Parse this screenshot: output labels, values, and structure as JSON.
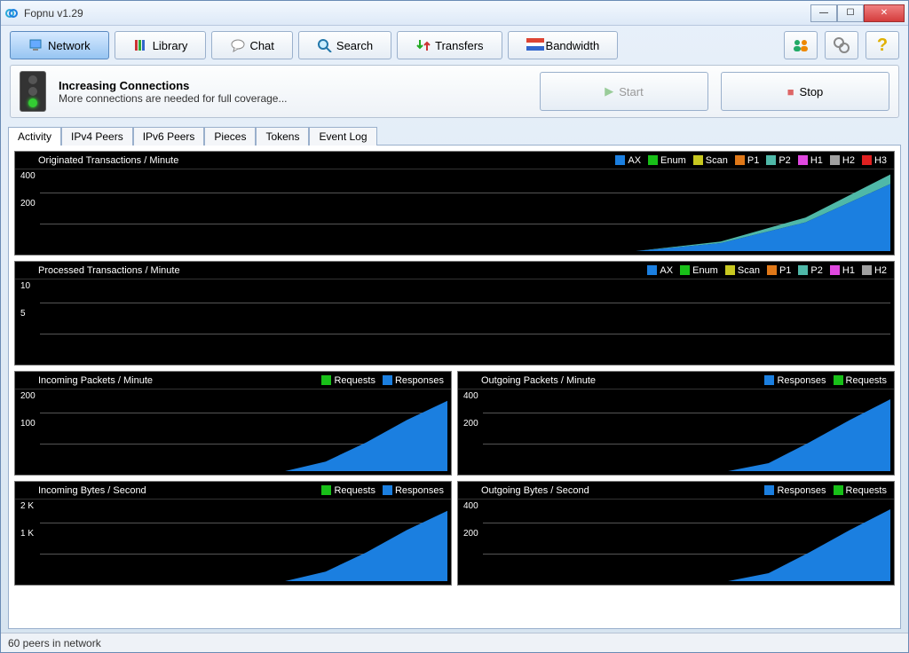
{
  "window": {
    "title": "Fopnu v1.29"
  },
  "toolbar": {
    "tabs": [
      {
        "label": "Network",
        "active": true
      },
      {
        "label": "Library",
        "active": false
      },
      {
        "label": "Chat",
        "active": false
      },
      {
        "label": "Search",
        "active": false
      },
      {
        "label": "Transfers",
        "active": false
      },
      {
        "label": "Bandwidth",
        "active": false
      }
    ]
  },
  "status": {
    "title": "Increasing Connections",
    "subtitle": "More connections are needed for full coverage...",
    "start_label": "Start",
    "stop_label": "Stop"
  },
  "subtabs": [
    "Activity",
    "IPv4 Peers",
    "IPv6 Peers",
    "Pieces",
    "Tokens",
    "Event Log"
  ],
  "subtab_active": 0,
  "legend_colors": {
    "AX": "#1b7fe0",
    "Enum": "#18c018",
    "Scan": "#c8c820",
    "P1": "#e07818",
    "P2": "#4fb8a8",
    "H1": "#e048e0",
    "H2": "#a0a0a0",
    "H3": "#e02020",
    "Requests": "#18c018",
    "Responses": "#1b7fe0"
  },
  "charts": [
    {
      "id": "orig",
      "title": "Originated Transactions / Minute",
      "full": true,
      "legend": [
        "AX",
        "Enum",
        "Scan",
        "P1",
        "P2",
        "H1",
        "H2",
        "H3"
      ],
      "yticks": [
        "400",
        "200"
      ]
    },
    {
      "id": "proc",
      "title": "Processed Transactions / Minute",
      "full": true,
      "legend": [
        "AX",
        "Enum",
        "Scan",
        "P1",
        "P2",
        "H1",
        "H2"
      ],
      "yticks": [
        "10",
        "5"
      ]
    },
    {
      "id": "ipk",
      "title": "Incoming Packets / Minute",
      "full": false,
      "legend": [
        "Requests",
        "Responses"
      ],
      "yticks": [
        "200",
        "100"
      ]
    },
    {
      "id": "opk",
      "title": "Outgoing Packets / Minute",
      "full": false,
      "legend": [
        "Responses",
        "Requests"
      ],
      "yticks": [
        "400",
        "200"
      ]
    },
    {
      "id": "ibs",
      "title": "Incoming Bytes / Second",
      "full": false,
      "legend": [
        "Requests",
        "Responses"
      ],
      "yticks": [
        "2 K",
        "1 K"
      ]
    },
    {
      "id": "obs",
      "title": "Outgoing Bytes / Second",
      "full": false,
      "legend": [
        "Responses",
        "Requests"
      ],
      "yticks": [
        "400",
        "200"
      ]
    }
  ],
  "chart_data": [
    {
      "id": "orig",
      "type": "area",
      "title": "Originated Transactions / Minute",
      "ylim": [
        0,
        500
      ],
      "x": [
        "t-10",
        "t-9",
        "t-8",
        "t-7",
        "t-6",
        "t-5",
        "t-4",
        "t-3",
        "t-2",
        "t-1",
        "now"
      ],
      "series": [
        {
          "name": "AX",
          "color": "#1b7fe0",
          "values": [
            0,
            0,
            0,
            0,
            0,
            0,
            0,
            0,
            50,
            180,
            420
          ]
        },
        {
          "name": "P2",
          "color": "#4fb8a8",
          "values": [
            0,
            0,
            0,
            0,
            0,
            0,
            0,
            0,
            10,
            30,
            60
          ]
        },
        {
          "name": "Enum",
          "color": "#18c018",
          "values": [
            0,
            0,
            0,
            0,
            0,
            0,
            0,
            0,
            0,
            0,
            0
          ]
        },
        {
          "name": "Scan",
          "color": "#c8c820",
          "values": [
            0,
            0,
            0,
            0,
            0,
            0,
            0,
            0,
            0,
            0,
            0
          ]
        },
        {
          "name": "P1",
          "color": "#e07818",
          "values": [
            0,
            0,
            0,
            0,
            0,
            0,
            0,
            0,
            0,
            0,
            0
          ]
        },
        {
          "name": "H1",
          "color": "#e048e0",
          "values": [
            0,
            0,
            0,
            0,
            0,
            0,
            0,
            0,
            0,
            0,
            0
          ]
        },
        {
          "name": "H2",
          "color": "#a0a0a0",
          "values": [
            0,
            0,
            0,
            0,
            0,
            0,
            0,
            0,
            0,
            0,
            0
          ]
        },
        {
          "name": "H3",
          "color": "#e02020",
          "values": [
            0,
            0,
            0,
            0,
            0,
            0,
            0,
            0,
            0,
            0,
            0
          ]
        }
      ]
    },
    {
      "id": "proc",
      "type": "area",
      "title": "Processed Transactions / Minute",
      "ylim": [
        0,
        12
      ],
      "x": [
        "t-10",
        "now"
      ],
      "series": [
        {
          "name": "AX",
          "color": "#1b7fe0",
          "values": [
            0,
            0
          ]
        },
        {
          "name": "Enum",
          "color": "#18c018",
          "values": [
            0,
            0
          ]
        },
        {
          "name": "Scan",
          "color": "#c8c820",
          "values": [
            0,
            0
          ]
        },
        {
          "name": "P1",
          "color": "#e07818",
          "values": [
            0,
            0
          ]
        },
        {
          "name": "P2",
          "color": "#4fb8a8",
          "values": [
            0,
            0
          ]
        },
        {
          "name": "H1",
          "color": "#e048e0",
          "values": [
            0,
            0
          ]
        },
        {
          "name": "H2",
          "color": "#a0a0a0",
          "values": [
            0,
            0
          ]
        }
      ]
    },
    {
      "id": "ipk",
      "type": "area",
      "title": "Incoming Packets / Minute",
      "ylim": [
        0,
        250
      ],
      "x": [
        "t-10",
        "t-9",
        "t-8",
        "t-7",
        "t-6",
        "t-5",
        "t-4",
        "t-3",
        "t-2",
        "t-1",
        "now"
      ],
      "series": [
        {
          "name": "Responses",
          "color": "#1b7fe0",
          "values": [
            0,
            0,
            0,
            0,
            0,
            0,
            0,
            30,
            90,
            160,
            220
          ]
        },
        {
          "name": "Requests",
          "color": "#18c018",
          "values": [
            0,
            0,
            0,
            0,
            0,
            0,
            0,
            0,
            0,
            0,
            0
          ]
        }
      ]
    },
    {
      "id": "opk",
      "type": "area",
      "title": "Outgoing Packets / Minute",
      "ylim": [
        0,
        500
      ],
      "x": [
        "t-10",
        "t-9",
        "t-8",
        "t-7",
        "t-6",
        "t-5",
        "t-4",
        "t-3",
        "t-2",
        "t-1",
        "now"
      ],
      "series": [
        {
          "name": "Requests",
          "color": "#1b7fe0",
          "values": [
            0,
            0,
            0,
            0,
            0,
            0,
            0,
            50,
            180,
            320,
            450
          ]
        },
        {
          "name": "Responses",
          "color": "#18c018",
          "values": [
            0,
            0,
            0,
            0,
            0,
            0,
            0,
            0,
            0,
            0,
            0
          ]
        }
      ]
    },
    {
      "id": "ibs",
      "type": "area",
      "title": "Incoming Bytes / Second",
      "ylim": [
        0,
        2500
      ],
      "x": [
        "t-10",
        "t-9",
        "t-8",
        "t-7",
        "t-6",
        "t-5",
        "t-4",
        "t-3",
        "t-2",
        "t-1",
        "now"
      ],
      "series": [
        {
          "name": "Responses",
          "color": "#1b7fe0",
          "values": [
            0,
            0,
            0,
            0,
            0,
            0,
            0,
            300,
            900,
            1600,
            2200
          ]
        },
        {
          "name": "Requests",
          "color": "#18c018",
          "values": [
            0,
            0,
            0,
            0,
            0,
            0,
            0,
            0,
            0,
            0,
            0
          ]
        }
      ]
    },
    {
      "id": "obs",
      "type": "area",
      "title": "Outgoing Bytes / Second",
      "ylim": [
        0,
        500
      ],
      "x": [
        "t-10",
        "t-9",
        "t-8",
        "t-7",
        "t-6",
        "t-5",
        "t-4",
        "t-3",
        "t-2",
        "t-1",
        "now"
      ],
      "series": [
        {
          "name": "Requests",
          "color": "#1b7fe0",
          "values": [
            0,
            0,
            0,
            0,
            0,
            0,
            0,
            50,
            180,
            320,
            450
          ]
        },
        {
          "name": "Responses",
          "color": "#18c018",
          "values": [
            0,
            0,
            0,
            0,
            0,
            0,
            0,
            0,
            0,
            0,
            0
          ]
        }
      ]
    }
  ],
  "statusbar": {
    "text": "60 peers in network"
  }
}
